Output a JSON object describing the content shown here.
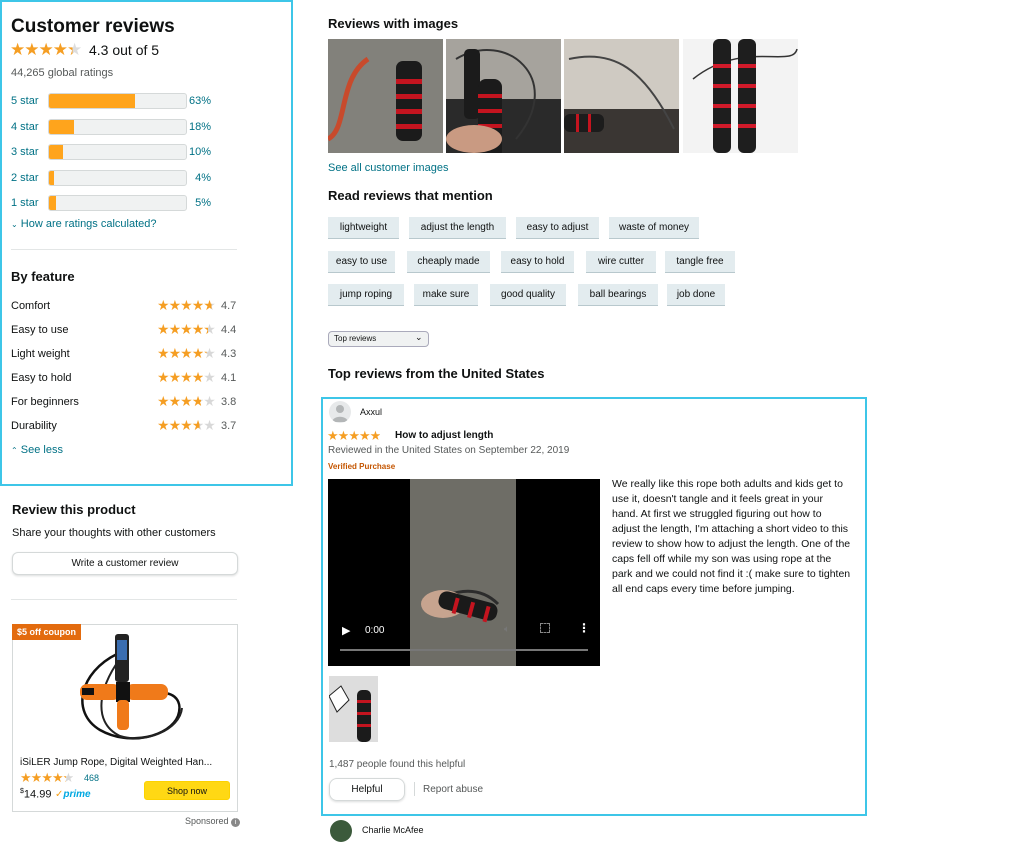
{
  "customer_reviews": {
    "title": "Customer reviews",
    "rating_text": "4.3 out of 5",
    "rating": 4.3,
    "global_ratings": "44,265 global ratings",
    "histogram": [
      {
        "label": "5 star",
        "percent_text": "63%",
        "percent": 63
      },
      {
        "label": "4 star",
        "percent_text": "18%",
        "percent": 18
      },
      {
        "label": "3 star",
        "percent_text": "10%",
        "percent": 10
      },
      {
        "label": "2 star",
        "percent_text": "4%",
        "percent": 4
      },
      {
        "label": "1 star",
        "percent_text": "5%",
        "percent": 5
      }
    ],
    "how_calculated": "How are ratings calculated?"
  },
  "by_feature": {
    "title": "By feature",
    "items": [
      {
        "name": "Comfort",
        "value": "4.7",
        "rating": 4.7
      },
      {
        "name": "Easy to use",
        "value": "4.4",
        "rating": 4.4
      },
      {
        "name": "Light weight",
        "value": "4.3",
        "rating": 4.3
      },
      {
        "name": "Easy to hold",
        "value": "4.1",
        "rating": 4.1
      },
      {
        "name": "For beginners",
        "value": "3.8",
        "rating": 3.8
      },
      {
        "name": "Durability",
        "value": "3.7",
        "rating": 3.7
      }
    ],
    "see_less": "See less"
  },
  "review_product": {
    "title": "Review this product",
    "subtitle": "Share your thoughts with other customers",
    "button": "Write a customer review"
  },
  "ad": {
    "coupon": "$5 off coupon",
    "title": "iSiLER Jump Rope, Digital Weighted Han...",
    "rating": 4.3,
    "count": "468",
    "price_symbol": "$",
    "price": "14.99",
    "prime": "prime",
    "button": "Shop now",
    "sponsored": "Sponsored",
    "accent_color": "#e36b0e"
  },
  "images_section": {
    "title": "Reviews with images",
    "see_all": "See all customer images"
  },
  "mentions": {
    "title": "Read reviews that mention",
    "rows": [
      [
        "lightweight",
        "adjust the length",
        "easy to adjust",
        "waste of money"
      ],
      [
        "easy to use",
        "cheaply made",
        "easy to hold",
        "wire cutter",
        "tangle free"
      ],
      [
        "jump roping",
        "make sure",
        "good quality",
        "ball bearings",
        "job done"
      ]
    ]
  },
  "sort": {
    "selected": "Top reviews"
  },
  "top_reviews_title": "Top reviews from the United States",
  "review": {
    "reviewer": "Axxul",
    "rating": 5,
    "title": "How to adjust length",
    "date": "Reviewed in the United States on September 22, 2019",
    "verified": "Verified Purchase",
    "video_time": "0:00",
    "body": "We really like this rope both adults and kids get to use it, doesn't tangle and it feels great in your hand. At first we struggled figuring out how to adjust the length, I'm attaching a short video to this review to show how to adjust the length. One of the caps fell off while my son was using rope at the park and we could not find it :( make sure to tighten all end caps every time before jumping.",
    "helpful_count": "1,487 people found this helpful",
    "helpful_button": "Helpful",
    "report": "Report abuse"
  },
  "next_reviewer": "Charlie McAfee",
  "colors": {
    "star": "#f59e23",
    "bar_fill": "#ffa41c",
    "link": "#007185",
    "highlight_box": "#3ec6e8"
  }
}
